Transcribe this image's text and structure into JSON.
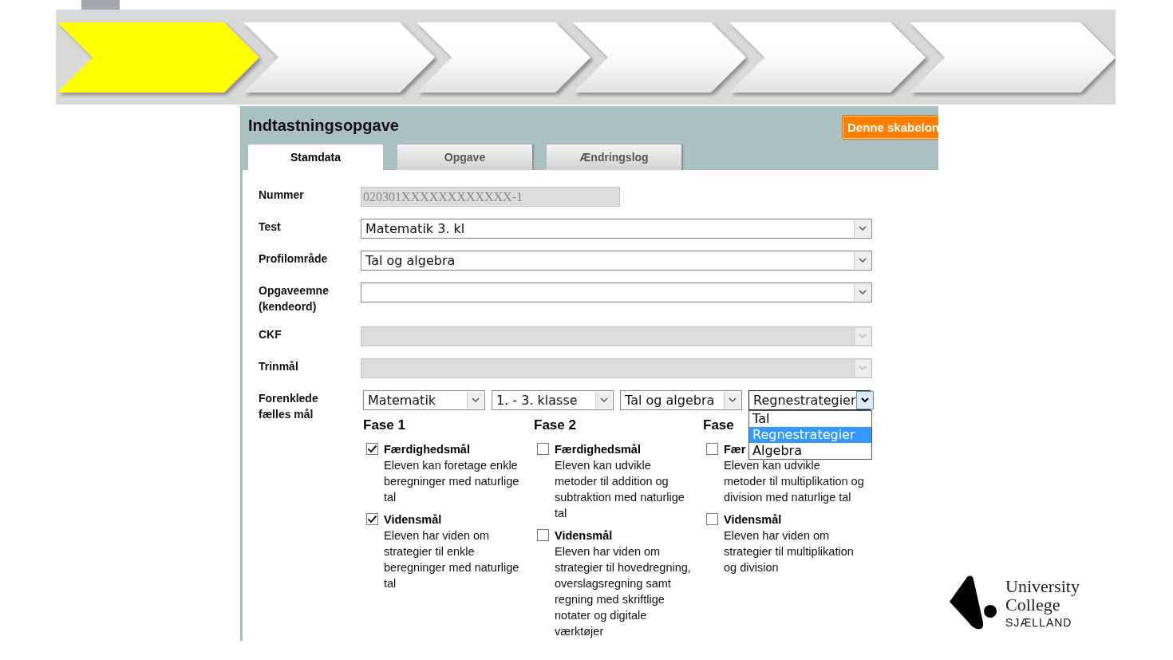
{
  "steps": [
    {
      "selected": true
    },
    {
      "selected": false
    },
    {
      "selected": false
    },
    {
      "selected": false
    },
    {
      "selected": false
    },
    {
      "selected": false
    }
  ],
  "panel": {
    "title": "Indtastningsopgave",
    "template_button": "Denne skabelon",
    "tabs": [
      {
        "label": "Stamdata",
        "selected": true
      },
      {
        "label": "Opgave",
        "selected": false
      },
      {
        "label": "Ændringslog",
        "selected": false
      }
    ],
    "fields": [
      {
        "label": "Nummer",
        "kind": "text",
        "value": "020301XXXXXXXXXXXX-1",
        "disabled": true
      },
      {
        "label": "Test",
        "kind": "select",
        "value": "Matematik 3. kl",
        "disabled": false
      },
      {
        "label": "Profilområde",
        "kind": "select",
        "value": "Tal og algebra",
        "disabled": false
      },
      {
        "label": "Opgaveemne (kendeord)",
        "kind": "select",
        "disabled": false
      },
      {
        "label": "CKF",
        "kind": "select",
        "disabled": true
      },
      {
        "label": "Trinmål",
        "kind": "select",
        "disabled": true
      }
    ],
    "goals_field": {
      "label": "Forenklede fælles mål",
      "selects": [
        {
          "value": "Matematik",
          "expanded": false
        },
        {
          "value": "1. - 3. klasse",
          "expanded": false
        },
        {
          "value": "Tal og algebra",
          "expanded": false
        },
        {
          "value": "Regnestrategier",
          "expanded": true,
          "options": [
            {
              "label": "Tal",
              "selected": false
            },
            {
              "label": "Regnestrategier",
              "selected": true
            },
            {
              "label": "Algebra",
              "selected": false
            }
          ]
        }
      ],
      "phases": [
        {
          "title": "Fase 1",
          "goals": [
            {
              "title": "Færdighedsmål",
              "checked": true,
              "text": "Eleven kan foretage enkle beregninger med naturlige tal"
            },
            {
              "title": "Vidensmål",
              "checked": true,
              "text": "Eleven har viden om strategier til enkle beregninger med naturlige tal"
            }
          ]
        },
        {
          "title": "Fase 2",
          "goals": [
            {
              "title": "Færdighedsmål",
              "checked": false,
              "text": "Eleven kan udvikle metoder til addition og subtraktion med naturlige tal"
            },
            {
              "title": "Vidensmål",
              "checked": false,
              "text": "Eleven har viden om strategier til hovedregning, overslagsregning samt regning med skriftlige notater og digitale værktøjer"
            }
          ]
        },
        {
          "title": "Fase",
          "goals": [
            {
              "title": "Fær",
              "checked": false,
              "text": "Eleven kan udvikle metoder til multiplikation og division med naturlige tal"
            },
            {
              "title": "Vidensmål",
              "checked": false,
              "text": "Eleven har viden om strategier til multiplikation og division"
            }
          ]
        }
      ]
    }
  },
  "logo": {
    "lines": [
      "University",
      "College",
      "SJÆLLAND"
    ]
  }
}
